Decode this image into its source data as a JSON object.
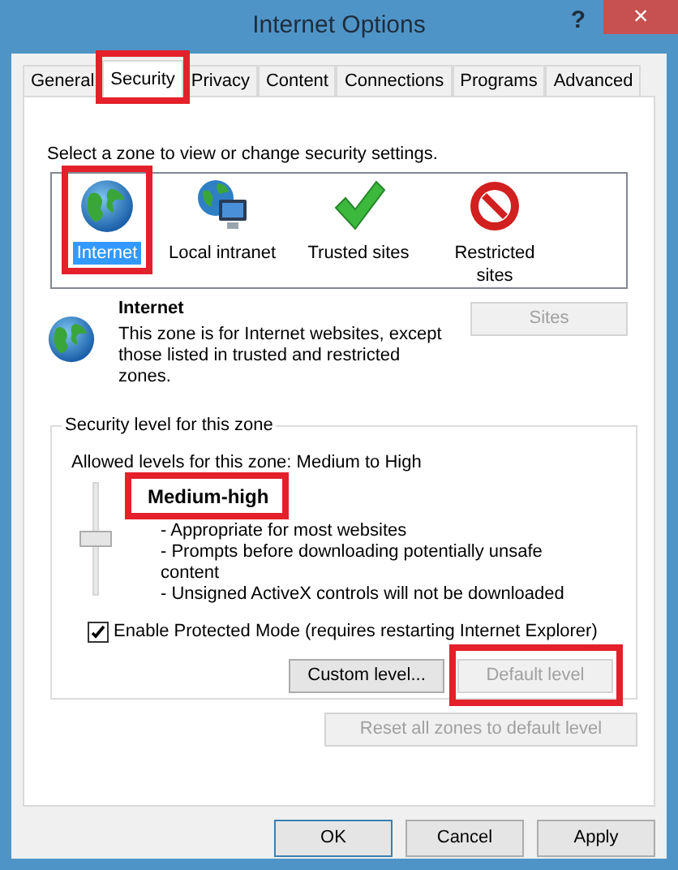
{
  "window": {
    "title": "Internet Options",
    "help": "?",
    "close": "×"
  },
  "tabs": [
    {
      "label": "General",
      "selected": false,
      "highlighted": false
    },
    {
      "label": "Security",
      "selected": true,
      "highlighted": true
    },
    {
      "label": "Privacy",
      "selected": false,
      "highlighted": false
    },
    {
      "label": "Content",
      "selected": false,
      "highlighted": false
    },
    {
      "label": "Connections",
      "selected": false,
      "highlighted": false
    },
    {
      "label": "Programs",
      "selected": false,
      "highlighted": false
    },
    {
      "label": "Advanced",
      "selected": false,
      "highlighted": false
    }
  ],
  "zone_prompt": "Select a zone to view or change security settings.",
  "zones": [
    {
      "label": "Internet",
      "kind": "internet",
      "selected": true,
      "highlighted": true
    },
    {
      "label": "Local intranet",
      "kind": "intranet",
      "selected": false,
      "highlighted": false
    },
    {
      "label": "Trusted sites",
      "kind": "trusted",
      "selected": false,
      "highlighted": false
    },
    {
      "label": "Restricted sites",
      "kind": "restricted",
      "selected": false,
      "highlighted": false
    }
  ],
  "zone_info": {
    "title": "Internet",
    "description": "This zone is for Internet websites, except those listed in trusted and restricted zones.",
    "sites_button": {
      "label": "Sites",
      "disabled": true
    }
  },
  "security_level": {
    "group_title": "Security level for this zone",
    "allowed": "Allowed levels for this zone: Medium to High",
    "level": 0.5,
    "level_name": "Medium-high",
    "level_highlighted": true,
    "bullets": [
      "- Appropriate for most websites",
      "- Prompts before downloading potentially unsafe content",
      "- Unsigned ActiveX controls will not be downloaded"
    ],
    "protected_mode": {
      "label": "Enable Protected Mode (requires restarting Internet Explorer)",
      "checked": true
    },
    "buttons": [
      {
        "label": "Custom level...",
        "disabled": false,
        "highlighted": false
      },
      {
        "label": "Default level",
        "disabled": true,
        "highlighted": true
      }
    ]
  },
  "reset_button": {
    "label": "Reset all zones to default level",
    "disabled": true
  },
  "dialog_buttons": [
    {
      "label": "OK",
      "default": true
    },
    {
      "label": "Cancel",
      "default": false
    },
    {
      "label": "Apply",
      "default": false
    }
  ]
}
